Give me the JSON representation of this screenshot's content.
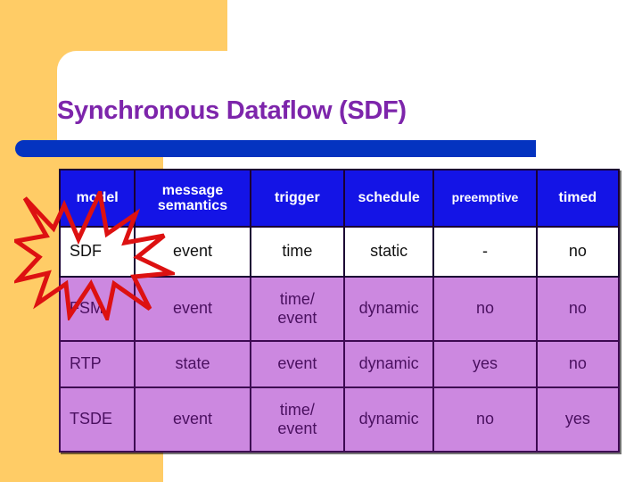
{
  "slide": {
    "title": "Synchronous Dataflow (SDF)",
    "accent_purple": "#7d25ab",
    "accent_blue": "#0433c0",
    "background_yellow": "#ffcc66",
    "header_blue": "#1414e6",
    "row_purple": "#cc88e0"
  },
  "annotation": {
    "shape": "starburst",
    "color": "#dd1111",
    "highlights_row": "SDF"
  },
  "table": {
    "columns": [
      {
        "key": "model",
        "label": "model"
      },
      {
        "key": "message_semantics",
        "label": "message semantics"
      },
      {
        "key": "trigger",
        "label": "trigger"
      },
      {
        "key": "schedule",
        "label": "schedule"
      },
      {
        "key": "preemptive",
        "label": "preemptive"
      },
      {
        "key": "timed",
        "label": "timed"
      }
    ],
    "rows": [
      {
        "model": "SDF",
        "message_semantics": "event",
        "trigger": "time",
        "schedule": "static",
        "preemptive": "-",
        "timed": "no"
      },
      {
        "model": "FSM",
        "message_semantics": "event",
        "trigger": "time/ event",
        "schedule": "dynamic",
        "preemptive": "no",
        "timed": "no"
      },
      {
        "model": "RTP",
        "message_semantics": "state",
        "trigger": "event",
        "schedule": "dynamic",
        "preemptive": "yes",
        "timed": "no"
      },
      {
        "model": "TSDE",
        "message_semantics": "event",
        "trigger": "time/ event",
        "schedule": "dynamic",
        "preemptive": "no",
        "timed": "yes"
      }
    ]
  }
}
